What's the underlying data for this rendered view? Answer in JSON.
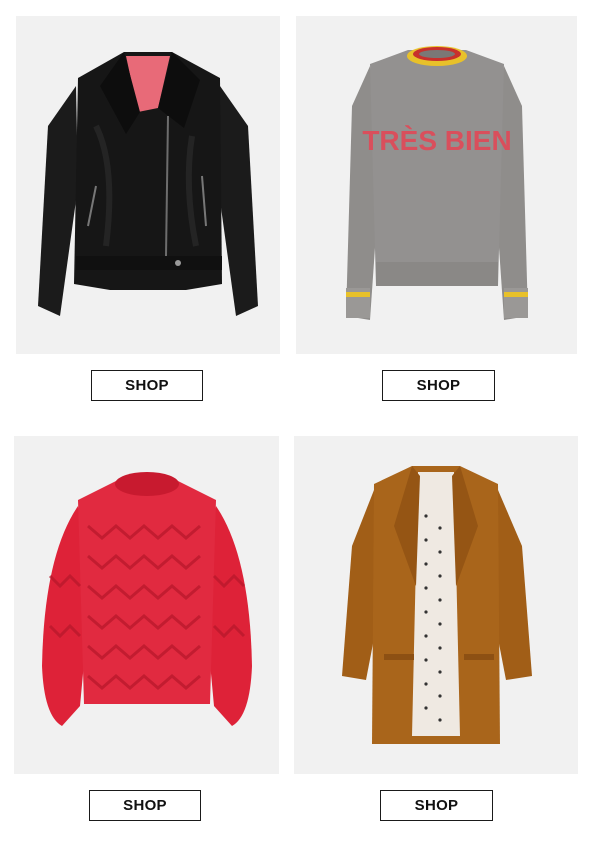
{
  "products": [
    {
      "name": "leather-jacket",
      "image_label": "",
      "shop_label": "SHOP",
      "color": "#141414"
    },
    {
      "name": "tres-bien-sweater",
      "image_label": "TRÈS BIEN",
      "shop_label": "SHOP",
      "color": "#8e8c8a"
    },
    {
      "name": "red-cable-knit-sweater",
      "image_label": "",
      "shop_label": "SHOP",
      "color": "#e0243c"
    },
    {
      "name": "mustard-blazer",
      "image_label": "",
      "shop_label": "SHOP",
      "color": "#a8631a"
    }
  ],
  "colors": {
    "tile_background": "#f1f1f1",
    "button_border": "#1a1a1a",
    "button_text": "#111111"
  }
}
